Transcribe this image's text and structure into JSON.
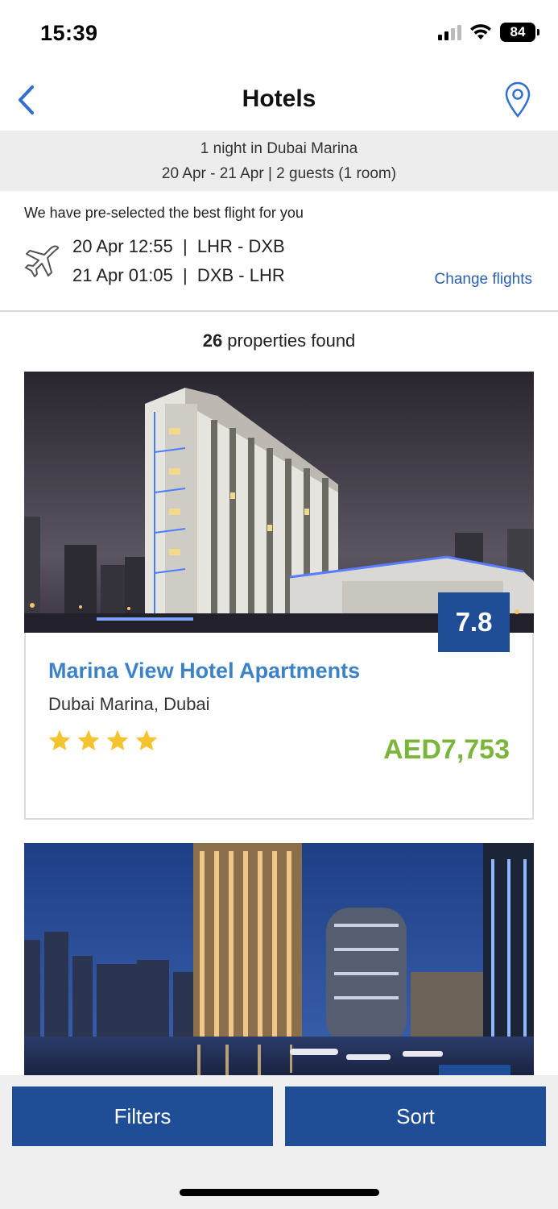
{
  "status_bar": {
    "time": "15:39",
    "battery": "84"
  },
  "nav": {
    "title": "Hotels"
  },
  "summary": {
    "line1": "1 night in Dubai Marina",
    "line2": "20 Apr - 21 Apr | 2 guests (1 room)"
  },
  "flights": {
    "preselect_text": "We have pre-selected the best flight for you",
    "outbound": "20 Apr 12:55  |  LHR - DXB",
    "return": "21 Apr 01:05  |  DXB - LHR",
    "change_label": "Change flights"
  },
  "results": {
    "count": "26",
    "label": " properties found"
  },
  "hotels": [
    {
      "name": "Marina View Hotel Apartments",
      "location": "Dubai Marina, Dubai",
      "score": "7.8",
      "stars": 4,
      "price": "AED7,753"
    }
  ],
  "bottom_bar": {
    "filters_label": "Filters",
    "sort_label": "Sort"
  },
  "colors": {
    "brand_blue": "#1f4e97",
    "link_blue": "#2b5fb0",
    "hotel_name_blue": "#3b82c9",
    "price_green": "#7cb53c",
    "star_yellow": "#f4c430"
  }
}
